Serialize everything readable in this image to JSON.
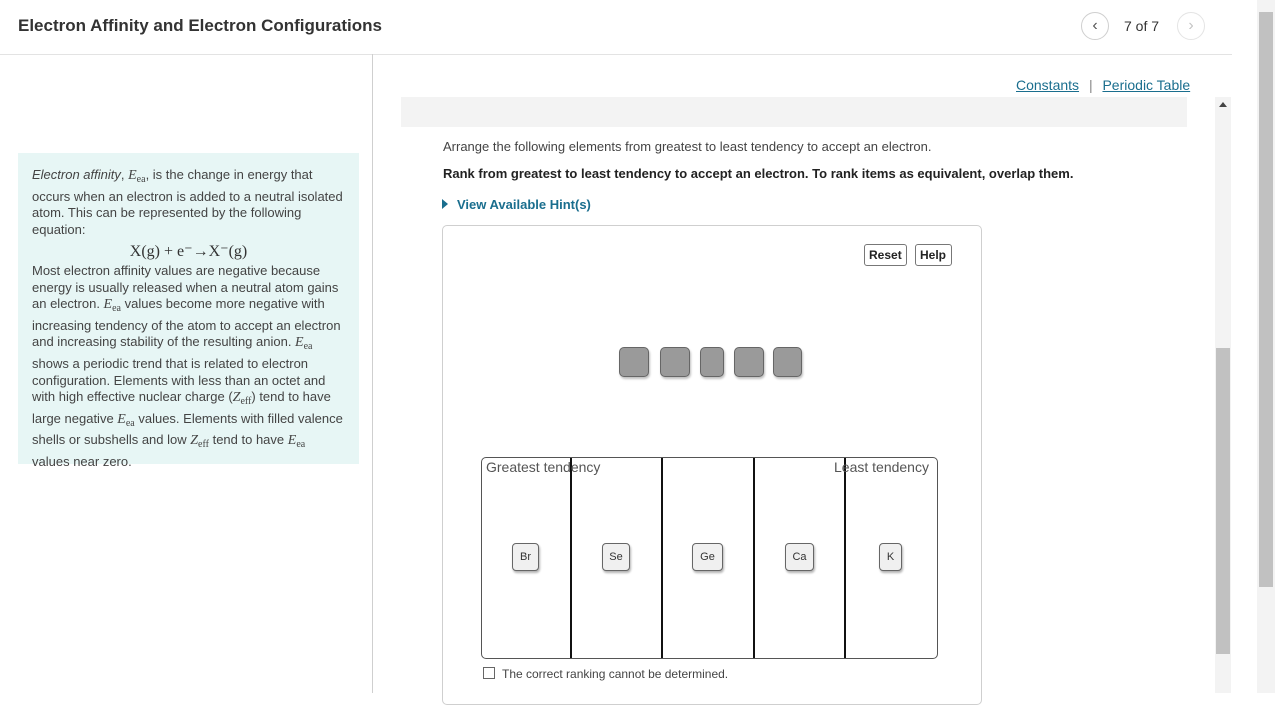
{
  "header": {
    "title": "Electron Affinity and Electron Configurations",
    "counter": "7 of 7",
    "prev_icon": "‹",
    "next_icon": "›"
  },
  "intro": {
    "term": "Electron affinity",
    "symbol": "E",
    "symbol_sub": "ea",
    "s1_rest": ", is the change in energy that occurs when an electron is added to a neutral isolated atom. This can be represented by the following equation:",
    "equation": "X(g) + e⁻→X⁻(g)",
    "s2": "Most electron affinity values are negative because energy is usually released when a neutral atom gains an electron. ",
    "s3": " values become more negative with increasing tendency of the atom to accept an electron and increasing stability of the resulting anion. ",
    "s4": " shows a periodic trend that is related to electron configuration. Elements with less than an octet and with high effective nuclear charge (",
    "zeff_symbol": "Z",
    "zeff_sub": "eff",
    "s5": ") tend to have large negative ",
    "s6": " values. Elements with filled valence shells or subshells and low ",
    "s7": " tend to have ",
    "s8": " values near zero."
  },
  "links": {
    "constants": "Constants",
    "separator": "|",
    "periodic_table": "Periodic Table"
  },
  "question": {
    "prompt": "Arrange the following elements from greatest to least tendency to accept an electron.",
    "instruction": "Rank from greatest to least tendency to accept an electron. To rank items as equivalent, overlap them.",
    "hint": "View Available Hint(s)"
  },
  "workspace": {
    "reset_label": "Reset",
    "help_label": "Help",
    "greatest_label": "Greatest tendency",
    "least_label": "Least tendency",
    "chips": [
      "Br",
      "Se",
      "Ge",
      "Ca",
      "K"
    ],
    "cannot_determine_label": "The correct ranking cannot be determined."
  }
}
